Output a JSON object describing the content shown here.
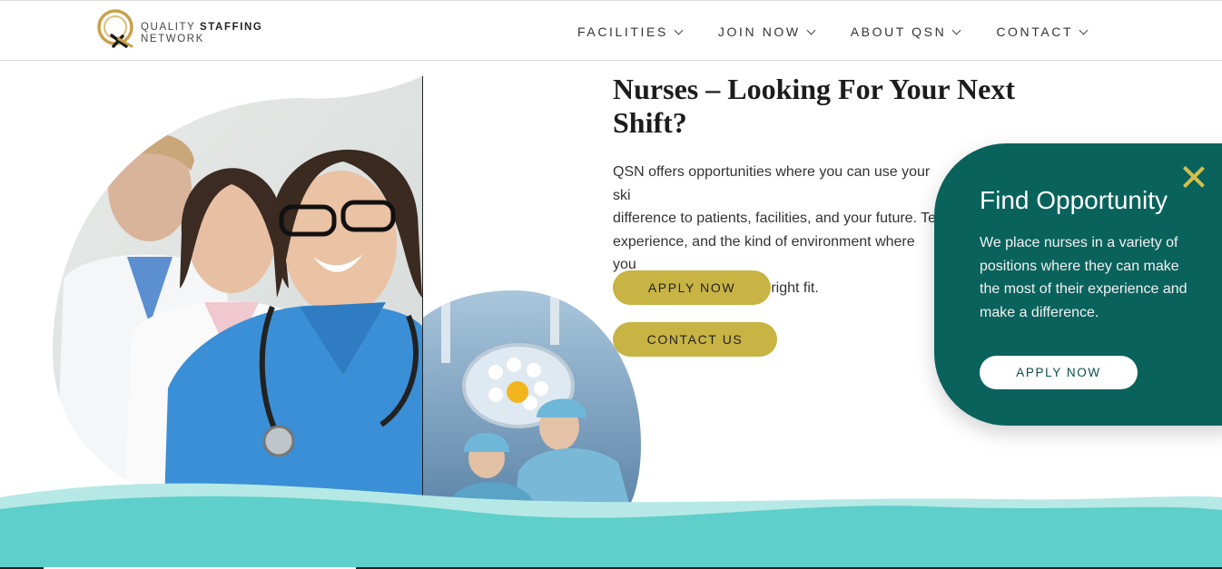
{
  "brand": {
    "line1_light": "QUALITY",
    "line1_bold": "STAFFING",
    "line2": "NETWORK",
    "gold": "#c8a24a",
    "dark": "#1c1c1c"
  },
  "nav": {
    "items": [
      {
        "label": "FACILITIES"
      },
      {
        "label": "JOIN NOW"
      },
      {
        "label": "ABOUT QSN"
      },
      {
        "label": "CONTACT"
      }
    ]
  },
  "hero": {
    "title": "Nurses – Looking For Your Next Shift?",
    "text": "QSN offers opportunities where you can use your ski\ndifference to patients, facilities, and your future. Te\nexperience, and the kind of environment where you\nbest to help you find the right fit.",
    "apply_label": "APPLY NOW",
    "contact_label": "CONTACT US",
    "button_color": "#c8b444"
  },
  "popup": {
    "title": "Find Opportunity",
    "text": "We place nurses in a variety of positions where they can make the most of their experience and make a difference.",
    "button_label": "APPLY NOW",
    "bg_color": "#0a625c",
    "close_color": "#d3c04c"
  },
  "images": {
    "left_photo": "nurses-group-photo",
    "right_photo": "surgeons-operating-room-photo"
  },
  "wave": {
    "color_main": "#5ecfca",
    "color_light": "#b6e9e6"
  }
}
